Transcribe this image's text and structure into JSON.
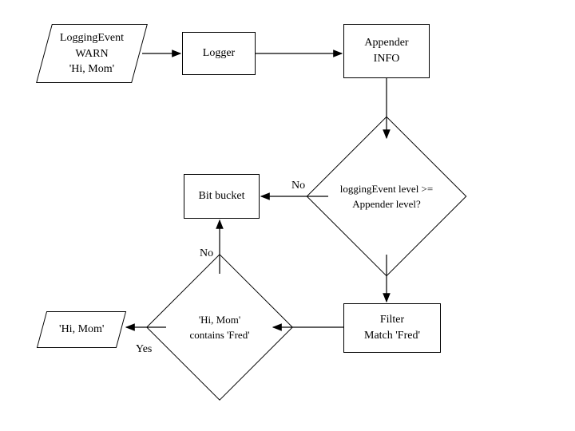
{
  "chart_data": {
    "type": "flowchart",
    "title": "",
    "nodes": [
      {
        "id": "loggingEvent",
        "shape": "parallelogram",
        "lines": [
          "LoggingEvent",
          "WARN",
          "'Hi, Mom'"
        ]
      },
      {
        "id": "logger",
        "shape": "rectangle",
        "lines": [
          "Logger"
        ]
      },
      {
        "id": "appender",
        "shape": "rectangle",
        "lines": [
          "Appender",
          "INFO"
        ]
      },
      {
        "id": "levelCheck",
        "shape": "decision",
        "lines": [
          "loggingEvent level >=",
          "Appender level?"
        ]
      },
      {
        "id": "bitBucket",
        "shape": "rectangle",
        "lines": [
          "Bit bucket"
        ]
      },
      {
        "id": "filter",
        "shape": "rectangle",
        "lines": [
          "Filter",
          "Match 'Fred'"
        ]
      },
      {
        "id": "containsFred",
        "shape": "decision",
        "lines": [
          "'Hi, Mom'",
          "contains 'Fred'"
        ]
      },
      {
        "id": "output",
        "shape": "parallelogram",
        "lines": [
          "'Hi, Mom'"
        ]
      }
    ],
    "edges": [
      {
        "from": "loggingEvent",
        "to": "logger",
        "label": ""
      },
      {
        "from": "logger",
        "to": "appender",
        "label": ""
      },
      {
        "from": "appender",
        "to": "levelCheck",
        "label": ""
      },
      {
        "from": "levelCheck",
        "to": "bitBucket",
        "label": "No"
      },
      {
        "from": "levelCheck",
        "to": "filter",
        "label": ""
      },
      {
        "from": "filter",
        "to": "containsFred",
        "label": ""
      },
      {
        "from": "containsFred",
        "to": "bitBucket",
        "label": "No"
      },
      {
        "from": "containsFred",
        "to": "output",
        "label": "Yes"
      }
    ]
  },
  "labels": {
    "no": "No",
    "yes": "Yes"
  }
}
